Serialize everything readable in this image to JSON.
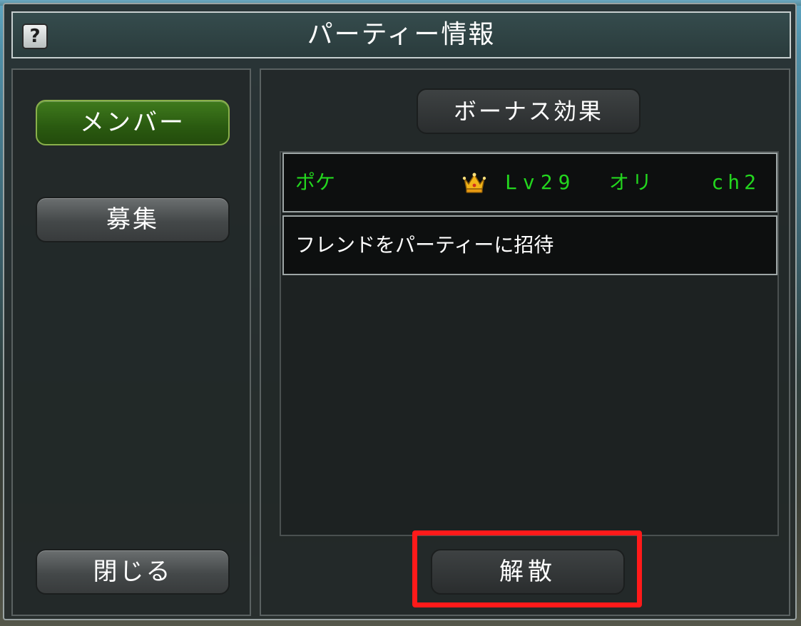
{
  "window": {
    "title": "パーティー情報",
    "help_label": "?"
  },
  "sidebar": {
    "items": [
      {
        "label": "メンバー",
        "active": true
      },
      {
        "label": "募集",
        "active": false
      }
    ],
    "close_label": "閉じる"
  },
  "main": {
    "bonus_label": "ボーナス効果",
    "member": {
      "name": "ポケ",
      "leader_icon": "crown-icon",
      "level": "Lv29",
      "job": "オリ",
      "channel": "ch2",
      "color": "#23d61e"
    },
    "invite_label": "フレンドをパーティーに招待",
    "disband_label": "解散"
  },
  "colors": {
    "active_tab": "#2a5a10",
    "member_text": "#23d61e",
    "highlight": "#ff1a1a"
  }
}
